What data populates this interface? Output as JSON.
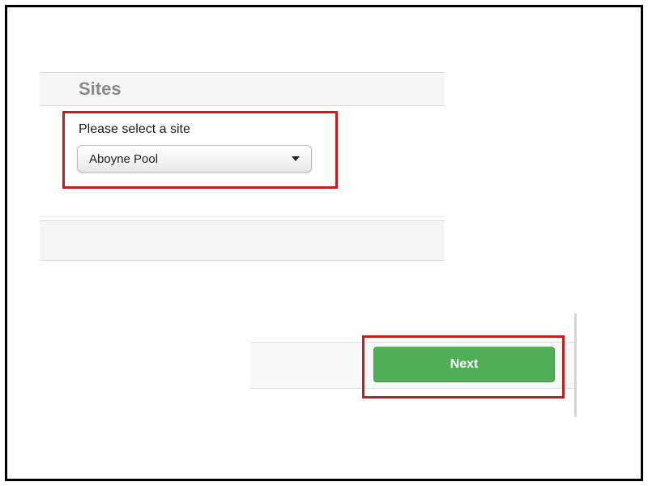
{
  "section": {
    "title": "Sites"
  },
  "form": {
    "site_select": {
      "label": "Please select a site",
      "value": "Aboyne Pool"
    }
  },
  "actions": {
    "next_label": "Next"
  }
}
